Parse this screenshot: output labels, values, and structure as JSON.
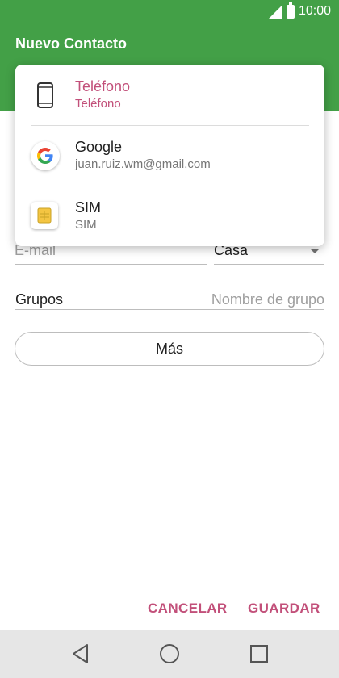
{
  "status_bar": {
    "time": "10:00"
  },
  "app_bar": {
    "title": "Nuevo Contacto"
  },
  "account_dropdown": {
    "items": [
      {
        "name": "Teléfono",
        "subtitle": "Teléfono",
        "icon": "phone-icon",
        "selected": true
      },
      {
        "name": "Google",
        "subtitle": "juan.ruiz.wm@gmail.com",
        "icon": "google-icon",
        "selected": false
      },
      {
        "name": "SIM",
        "subtitle": "SIM",
        "icon": "sim-card-icon",
        "selected": false
      }
    ]
  },
  "form": {
    "email": {
      "placeholder": "E-mail",
      "type_value": "Casa"
    },
    "groups": {
      "label": "Grupos",
      "placeholder": "Nombre de grupo"
    },
    "more_label": "Más"
  },
  "actions": {
    "cancel_label": "CANCELAR",
    "save_label": "GUARDAR"
  },
  "colors": {
    "primary": "#43a047",
    "accent": "#c2507a"
  },
  "nav_bar": {
    "icons": [
      "back-icon",
      "home-icon",
      "recents-icon"
    ]
  }
}
